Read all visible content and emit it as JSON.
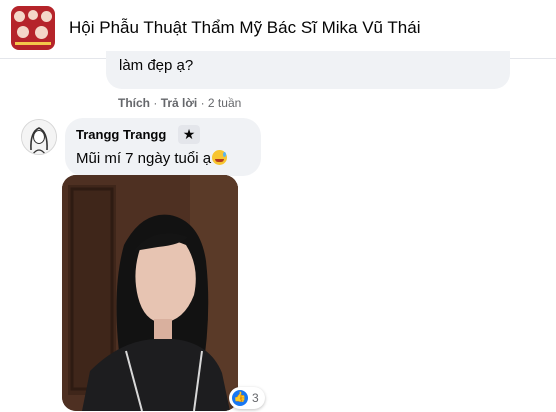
{
  "header": {
    "group_title": "Hội Phẫu Thuật Thẩm Mỹ Bác Sĩ Mika Vũ Thái"
  },
  "previous_comment": {
    "text_tail": "làm đẹp ạ?",
    "actions": {
      "like": "Thích",
      "reply": "Trả lời",
      "time": "2 tuần"
    }
  },
  "comment": {
    "author": "Trangg Trangg",
    "badge_icon": "star-icon",
    "text": "Mũi mí 7 ngày tuổi ạ",
    "emoji": "grinning-sweat-emoji",
    "reaction_icon": "like-icon",
    "reaction_count": "3"
  },
  "colors": {
    "bubble": "#f0f2f5",
    "text": "#050505",
    "meta": "#65676b",
    "like_blue": "#1877f2",
    "group_avatar_red": "#b5242a"
  }
}
